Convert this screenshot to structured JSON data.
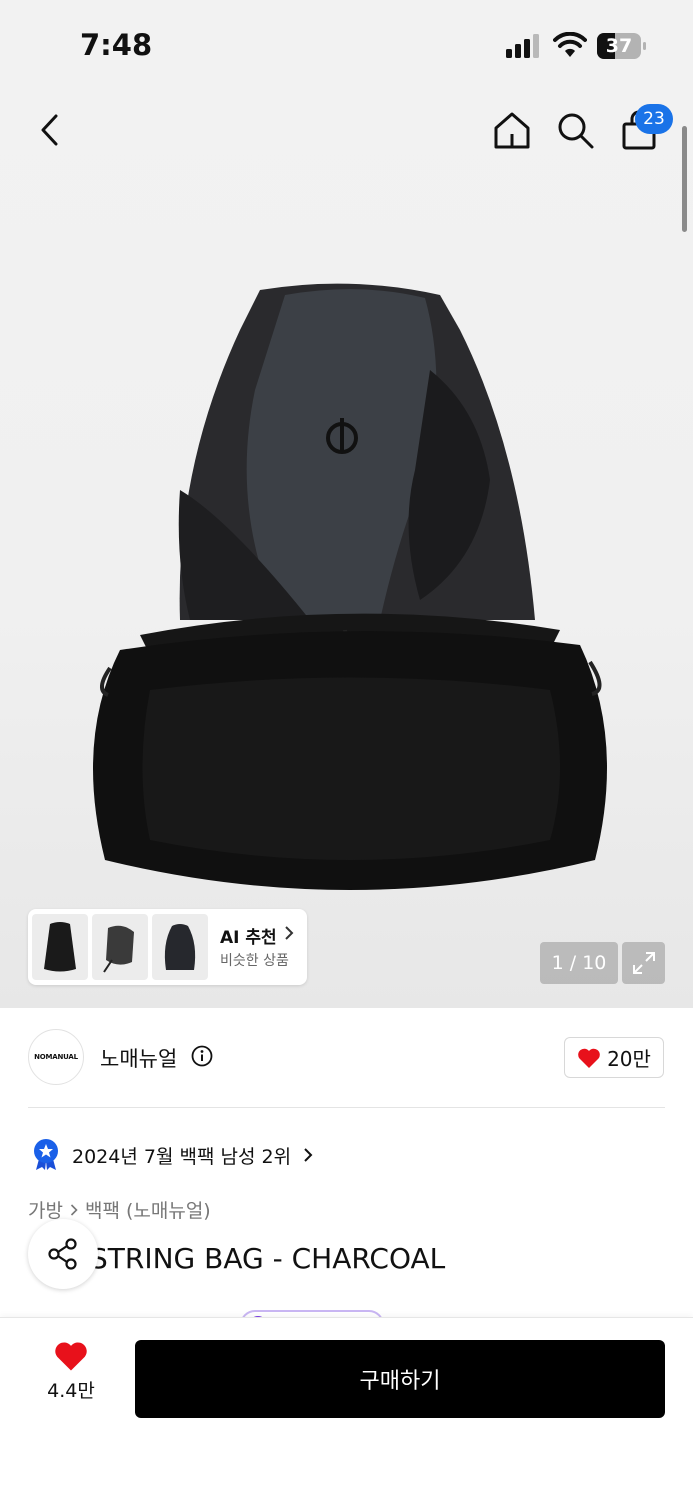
{
  "status_bar": {
    "time": "7:48",
    "battery": "37"
  },
  "header": {
    "cart_count": "23"
  },
  "gallery": {
    "counter": "1 / 10",
    "ai_recommendation": {
      "title": "AI 추천",
      "subtitle": "비슷한 상품"
    }
  },
  "brand": {
    "logo_text": "NOMANUAL",
    "name": "노매뉴얼",
    "likes": "20만"
  },
  "ranking": {
    "text": "2024년 7월 백팩 남성 2위"
  },
  "breadcrumb": {
    "category": "가방",
    "subcategory": "백팩 (노매뉴얼)"
  },
  "product": {
    "title": "STRING BAG - CHARCOAL"
  },
  "bottom_bar": {
    "wish_count": "4.4만",
    "buy_label": "구매하기"
  },
  "colors": {
    "accent_blue": "#1a73e8",
    "heart_red": "#e8111b",
    "buy_button": "#000000",
    "promo_purple": "#7b3fe4"
  },
  "icons": [
    "back-arrow-icon",
    "home-icon",
    "search-icon",
    "shopping-bag-icon",
    "expand-icon",
    "info-icon",
    "heart-icon",
    "ranking-badge-icon",
    "chevron-right-icon",
    "share-icon"
  ]
}
